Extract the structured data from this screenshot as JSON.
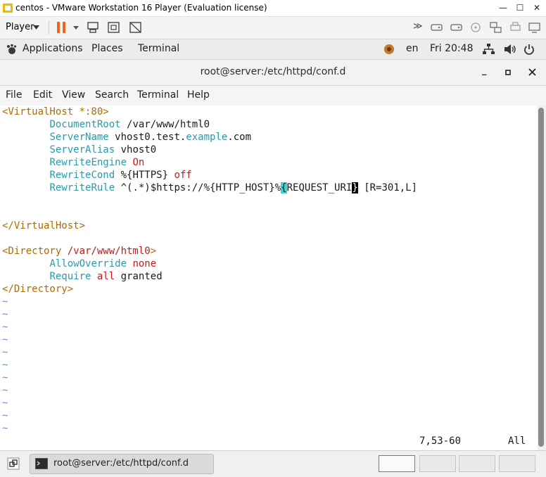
{
  "vm_window": {
    "title": "centos - VMware Workstation 16 Player (Evaluation license)",
    "player_label": "Player"
  },
  "gnome_bar": {
    "applications": "Applications",
    "places": "Places",
    "terminal": "Terminal",
    "input_lang": "en",
    "clock": "Fri 20:48"
  },
  "terminal": {
    "title": "root@server:/etc/httpd/conf.d",
    "menu": [
      "File",
      "Edit",
      "View",
      "Search",
      "Terminal",
      "Help"
    ],
    "status_position": "7,53-60",
    "status_scroll": "All"
  },
  "editor_lines": {
    "l1_tag": "<VirtualHost *:80>",
    "l2_kw": "DocumentRoot",
    "l2_rest": " /var/www/html0",
    "l3_kw": "ServerName",
    "l3_a": " vhost0.test.",
    "l3_b": "example",
    "l3_c": ".com",
    "l4_kw": "ServerAlias",
    "l4_rest": " vhost0",
    "l5_kw": "RewriteEngine",
    "l5_val": "On",
    "l6_kw": "RewriteCond",
    "l6_a": " %{HTTPS} ",
    "l6_val": "off",
    "l7_kw": "RewriteRule",
    "l7_a": " ^(.*)$https://%{HTTP_HOST}%",
    "l7_cur": "{",
    "l7_b": "REQUEST_URI",
    "l7_blk": "}",
    "l7_c": " [R=301,L]",
    "l10_tag": "</VirtualHost>",
    "l12_tag_a": "<Directory ",
    "l12_tag_b": "/var/www/html0",
    "l12_tag_c": ">",
    "l13_kw": "AllowOverride",
    "l13_val": "none",
    "l14_kw": "Require",
    "l14_val": "all",
    "l14_rest": " granted",
    "l15_tag": "</Directory>",
    "tilde": "~"
  },
  "taskbar": {
    "task_label": "root@server:/etc/httpd/conf.d"
  }
}
